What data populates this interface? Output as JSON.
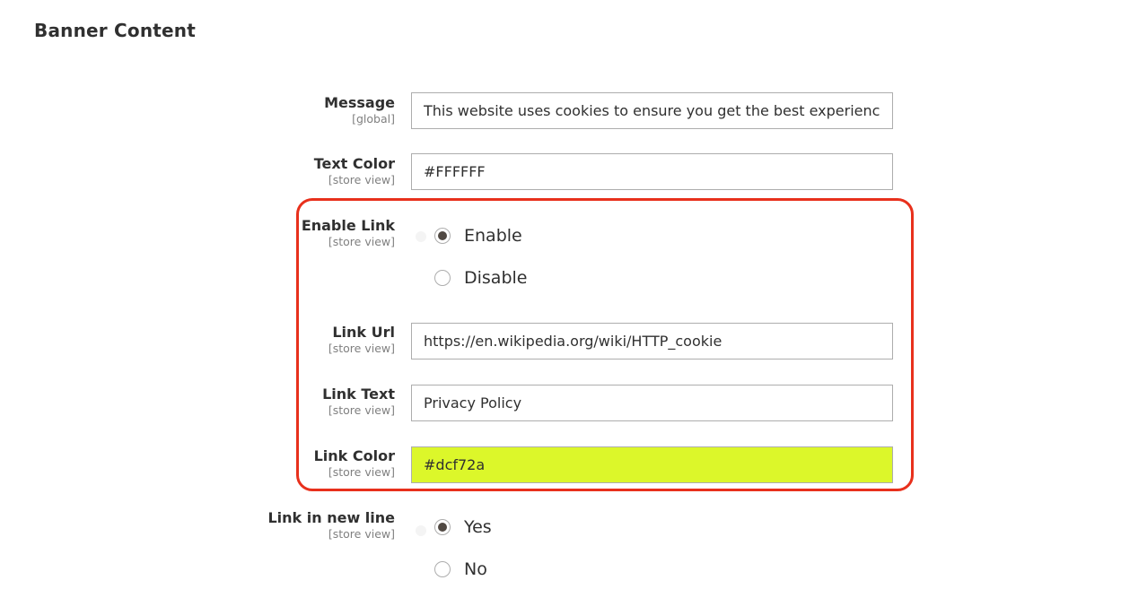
{
  "section": {
    "title": "Banner Content"
  },
  "fields": {
    "message": {
      "label": "Message",
      "scope": "[global]",
      "value": "This website uses cookies to ensure you get the best experienc"
    },
    "text_color": {
      "label": "Text Color",
      "scope": "[store view]",
      "value": "#FFFFFF"
    },
    "enable_link": {
      "label": "Enable Link",
      "scope": "[store view]",
      "options": [
        {
          "label": "Enable",
          "checked": true
        },
        {
          "label": "Disable",
          "checked": false
        }
      ]
    },
    "link_url": {
      "label": "Link Url",
      "scope": "[store view]",
      "value": "https://en.wikipedia.org/wiki/HTTP_cookie"
    },
    "link_text": {
      "label": "Link Text",
      "scope": "[store view]",
      "value": "Privacy Policy"
    },
    "link_color": {
      "label": "Link Color",
      "scope": "[store view]",
      "value": "#dcf72a"
    },
    "link_new_line": {
      "label": "Link in new line",
      "scope": "[store view]",
      "options": [
        {
          "label": "Yes",
          "checked": true
        },
        {
          "label": "No",
          "checked": false
        }
      ]
    }
  },
  "colors": {
    "highlight_frame": "#e8301c",
    "link_color_field_bg": "#dcf72a",
    "radio_checked": "#514943"
  }
}
